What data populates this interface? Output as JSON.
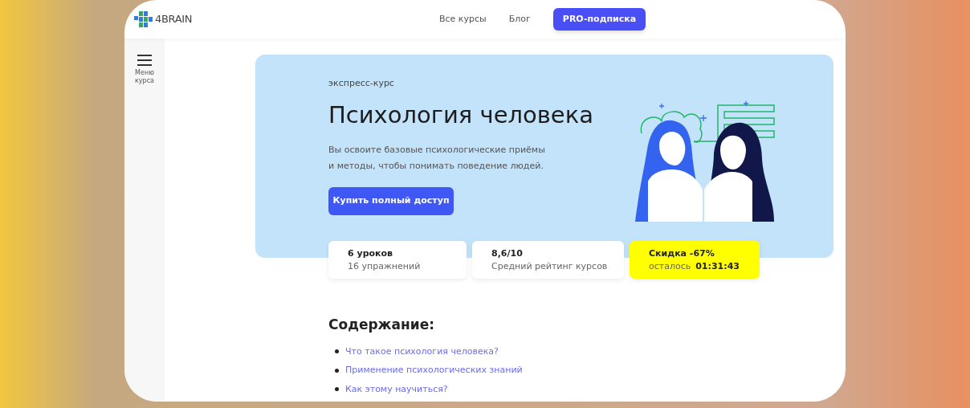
{
  "header": {
    "logo": "4BRAIN",
    "nav": [
      {
        "label": "Все курсы",
        "kind": "link"
      },
      {
        "label": "Блог",
        "kind": "link"
      },
      {
        "label": "PRO-подписка",
        "kind": "button"
      }
    ]
  },
  "sidebar": {
    "menu_label": "Меню курса"
  },
  "hero": {
    "eyebrow": "экспресс-курс",
    "title": "Психология человека",
    "description": "Вы освоите базовые психологические приёмы и методы, чтобы понимать поведение людей.",
    "cta": "Купить полный доступ"
  },
  "stats": [
    {
      "kind": "plain",
      "title": "6 уроков",
      "subtitle": "16 упражнений"
    },
    {
      "kind": "plain",
      "title": "8,6/10",
      "subtitle": "Средний рейтинг курсов"
    },
    {
      "kind": "promo",
      "title": "Скидка -67%",
      "subtitle": "осталось",
      "timer": "01:31:43"
    }
  ],
  "contents": {
    "heading": "Содержание:",
    "items": [
      "Что такое психология человека?",
      "Применение психологических знаний",
      "Как этому научиться?"
    ]
  }
}
